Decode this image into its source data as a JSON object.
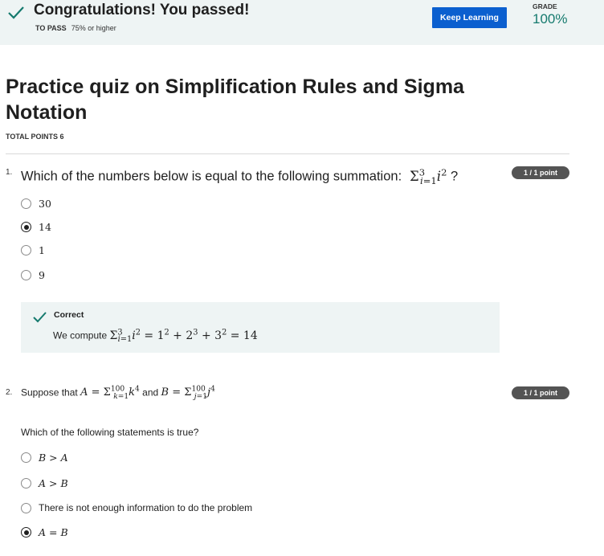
{
  "banner": {
    "title": "Congratulations! You passed!",
    "to_pass_label": "TO PASS",
    "to_pass_value": "75% or higher",
    "keep_learning_label": "Keep Learning",
    "grade_label": "GRADE",
    "grade_value": "100%",
    "check_icon": "check-icon",
    "accent_color": "#157a6e",
    "button_color": "#0b5fcf"
  },
  "quiz": {
    "title": "Practice quiz on Simplification Rules and Sigma Notation",
    "total_points": "TOTAL POINTS 6"
  },
  "questions": [
    {
      "number": "1.",
      "text": "Which of the numbers below is equal to the following summation:",
      "math": "Σ_{i=1}^{3} i^2",
      "suffix": "?",
      "points": "1 / 1 point",
      "options": [
        {
          "label": "30",
          "selected": false
        },
        {
          "label": "14",
          "selected": true
        },
        {
          "label": "1",
          "selected": false
        },
        {
          "label": "9",
          "selected": false
        }
      ],
      "feedback": {
        "status": "Correct",
        "text": "We compute",
        "math": "Σ_{i=1}^{3} i^2 = 1^2 + 2^3 + 3^2 = 14"
      }
    },
    {
      "number": "2.",
      "text_prefix": "Suppose that",
      "math_a": "A = Σ_{k=1}^{100} k^4",
      "text_and": "and",
      "math_b": "B = Σ_{j=1}^{100} j^4",
      "points": "1 / 1 point",
      "subquestion": "Which of the following statements is true?",
      "options": [
        {
          "label": "B > A",
          "selected": false
        },
        {
          "label": "A > B",
          "selected": false
        },
        {
          "label": "There is not enough information to do the problem",
          "selected": false
        },
        {
          "label": "A = B",
          "selected": true
        }
      ]
    }
  ]
}
